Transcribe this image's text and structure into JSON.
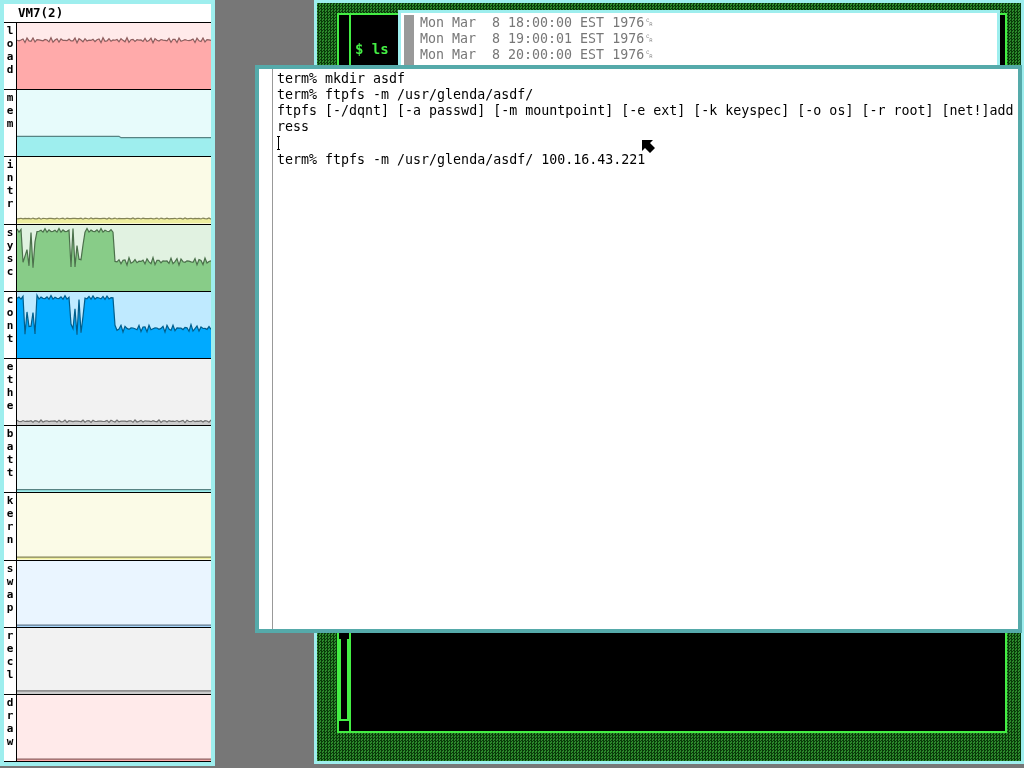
{
  "stats_window": {
    "title": "VM7(2)",
    "graphs": [
      {
        "label": "load",
        "color": "#ffaaaa"
      },
      {
        "label": "mem",
        "color": "#9eeeee"
      },
      {
        "label": "intr",
        "color": "#eeee9e"
      },
      {
        "label": "sysc",
        "color": "#88cc88"
      },
      {
        "label": "cont",
        "color": "#00aaff"
      },
      {
        "label": "ethe",
        "color": "#cccccc"
      },
      {
        "label": "batt",
        "color": "#9eeeee"
      },
      {
        "label": "kern",
        "color": "#eeee9e"
      },
      {
        "label": "swap",
        "color": "#aad8ff"
      },
      {
        "label": "recl",
        "color": "#cccccc"
      },
      {
        "label": "draw",
        "color": "#ffaaaa"
      }
    ]
  },
  "back_window": {
    "lines": [
      "$ ls"
    ]
  },
  "date_window": {
    "lines": [
      "Mon Mar  8 18:00:00 EST 1976␍",
      "Mon Mar  8 19:00:01 EST 1976␍",
      "Mon Mar  8 20:00:00 EST 1976␍"
    ]
  },
  "terminal_window": {
    "lines": [
      {
        "kind": "text",
        "text": "term% mkdir asdf"
      },
      {
        "kind": "text",
        "text": "term% ftpfs -m /usr/glenda/asdf/"
      },
      {
        "kind": "text",
        "text": "ftpfs [-/dqnt] [-a passwd] [-m mountpoint] [-e ext] [-k keyspec] [-o os] [-r root] [net!]add"
      },
      {
        "kind": "text",
        "text": "ress"
      },
      {
        "kind": "cursor"
      },
      {
        "kind": "text",
        "text": "term% ftpfs -m /usr/glenda/asdf/ 100.16.43.221"
      }
    ]
  }
}
